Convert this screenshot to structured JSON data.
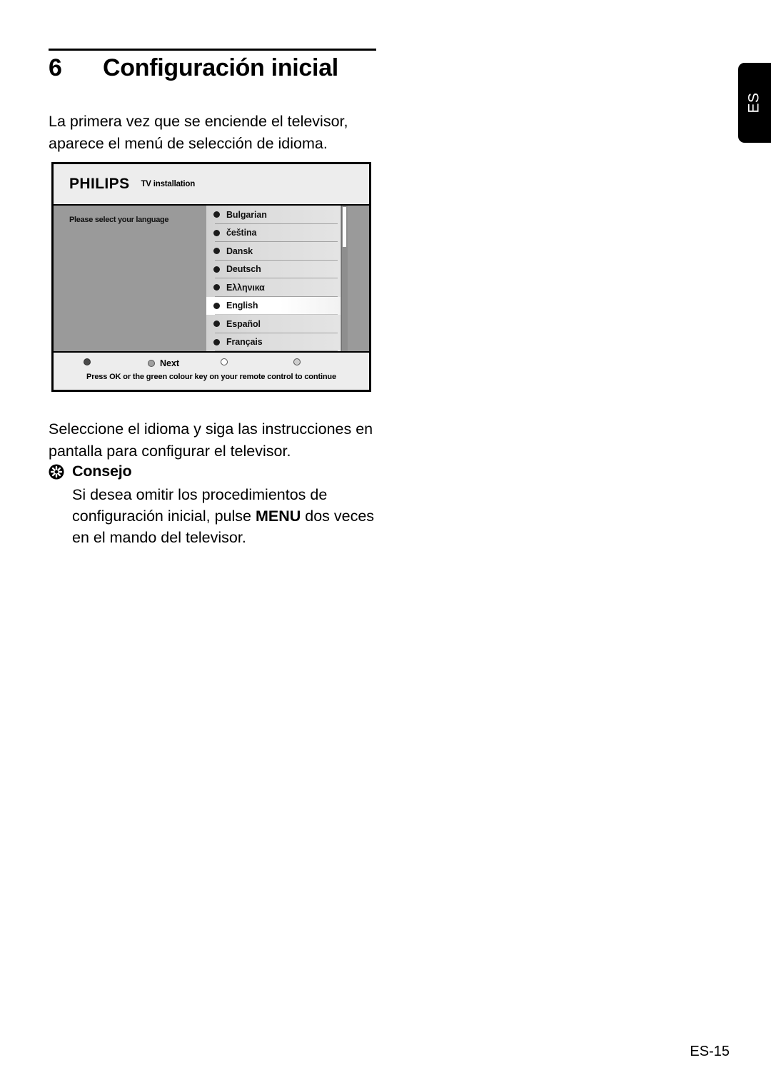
{
  "edge_tab": {
    "label": "ES"
  },
  "chapter": {
    "number": "6",
    "title": "Configuración inicial"
  },
  "intro_paragraph": "La primera vez que se enciende el televisor, aparece el menú de selección de idioma.",
  "tv_screen": {
    "brand": "PHILIPS",
    "screen_title": "TV installation",
    "prompt": "Please select your language",
    "languages": [
      {
        "label": "Bulgarian",
        "selected": false
      },
      {
        "label": "čeština",
        "selected": false
      },
      {
        "label": "Dansk",
        "selected": false
      },
      {
        "label": "Deutsch",
        "selected": false
      },
      {
        "label": "Ελληνικα",
        "selected": false
      },
      {
        "label": "English",
        "selected": true
      },
      {
        "label": "Español",
        "selected": false
      },
      {
        "label": "Français",
        "selected": false
      }
    ],
    "color_keys": [
      {
        "color_name": "red",
        "label": ""
      },
      {
        "color_name": "green",
        "label": "Next"
      },
      {
        "color_name": "yellow",
        "label": ""
      },
      {
        "color_name": "blue",
        "label": ""
      }
    ],
    "hint": "Press OK or the green colour key on your remote control to continue"
  },
  "body_paragraph": "Seleccione el idioma y siga las instrucciones en pantalla para configurar el televisor.",
  "tip": {
    "icon": "asterisk-badge-icon",
    "title": "Consejo",
    "text_before": "Si desea omitir los procedimientos de configuración inicial, pulse ",
    "emphasis": "MENU",
    "text_after": " dos veces en el mando del televisor."
  },
  "page_number": "ES-15",
  "colors": {
    "tv_body_gray": "#9a9a9a",
    "tv_chrome_gray": "#ededed",
    "ink": "#000000"
  }
}
